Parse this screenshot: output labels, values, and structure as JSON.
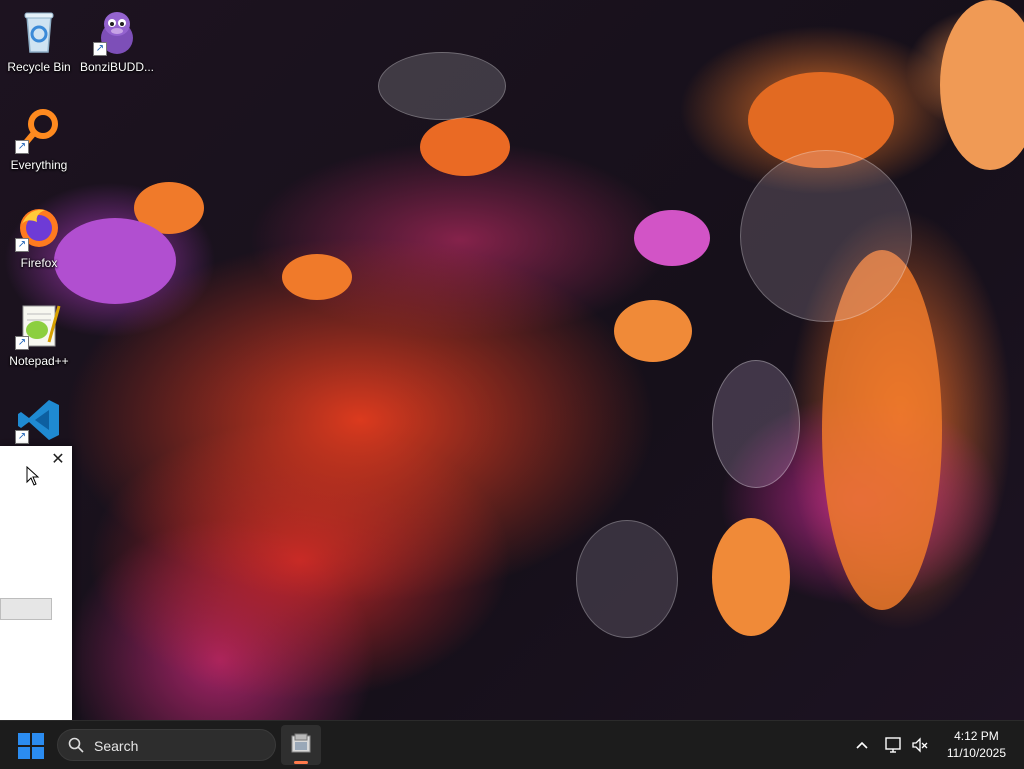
{
  "desktop": {
    "icons": [
      {
        "label": "Recycle Bin",
        "icon": "recycle-bin-icon"
      },
      {
        "label": "BonziBUDD...",
        "icon": "bonzibuddy-icon"
      },
      {
        "label": "Everything",
        "icon": "everything-search-icon"
      },
      {
        "label": "Firefox",
        "icon": "firefox-icon"
      },
      {
        "label": "Notepad++",
        "icon": "notepad-plus-plus-icon"
      },
      {
        "label": "",
        "icon": "vscode-icon"
      }
    ]
  },
  "dialog": {
    "close_glyph": "✕"
  },
  "taskbar": {
    "search_placeholder": "Search",
    "time": "4:12 PM",
    "date": "11/10/2025"
  },
  "colors": {
    "taskbar": "#1c1c1c",
    "accent": "#ff7a4c",
    "windows_blue": "#2b8cf0"
  }
}
